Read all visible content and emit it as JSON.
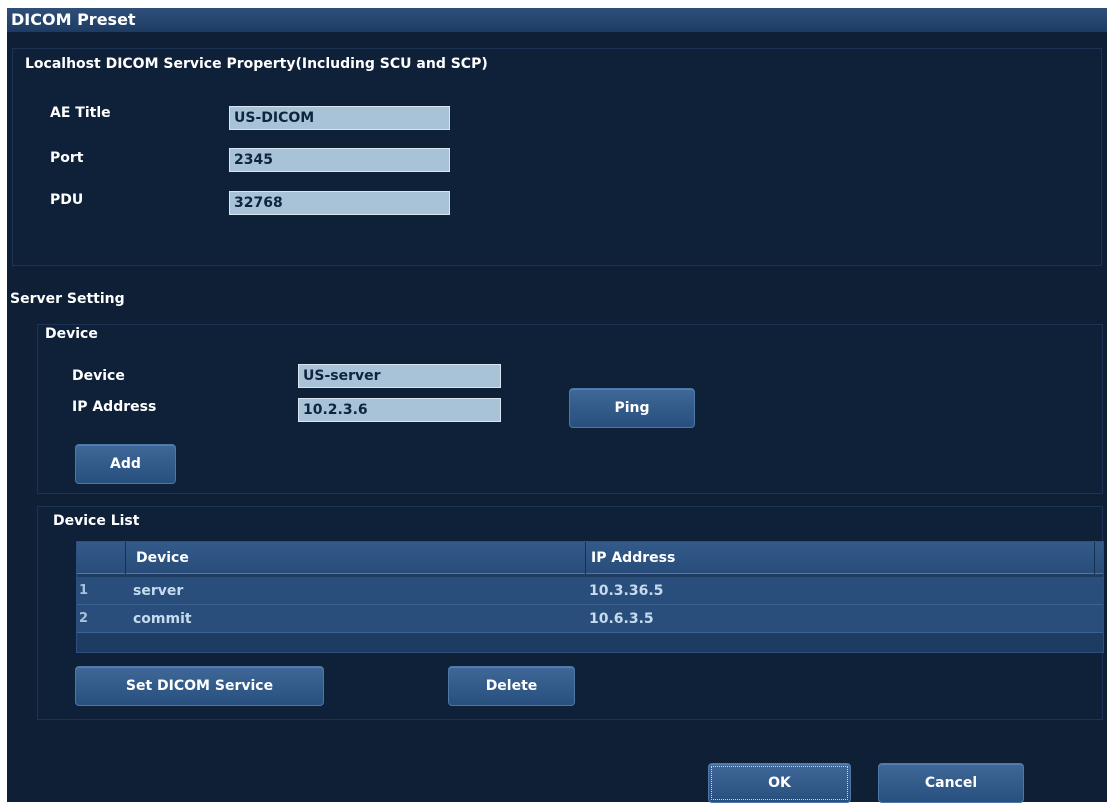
{
  "window": {
    "title": "DICOM Preset"
  },
  "local_service": {
    "title": "Localhost DICOM Service Property(Including SCU and SCP)",
    "ae_title_label": "AE Title",
    "ae_title_value": "US-DICOM",
    "port_label": "Port",
    "port_value": "2345",
    "pdu_label": "PDU",
    "pdu_value": "32768"
  },
  "server_setting": {
    "title": "Server Setting",
    "device_group_title": "Device",
    "device_label": "Device",
    "device_value": "US-server",
    "ip_label": "IP Address",
    "ip_value": "10.2.3.6",
    "ping_label": "Ping",
    "add_label": "Add"
  },
  "device_list": {
    "title": "Device List",
    "columns": [
      "Device",
      "IP Address"
    ],
    "rows": [
      {
        "index": "1",
        "device": "server",
        "ip": "10.3.36.5"
      },
      {
        "index": "2",
        "device": "commit",
        "ip": "10.6.3.5"
      }
    ],
    "set_service_label": "Set DICOM Service",
    "delete_label": "Delete"
  },
  "footer": {
    "ok_label": "OK",
    "cancel_label": "Cancel"
  }
}
